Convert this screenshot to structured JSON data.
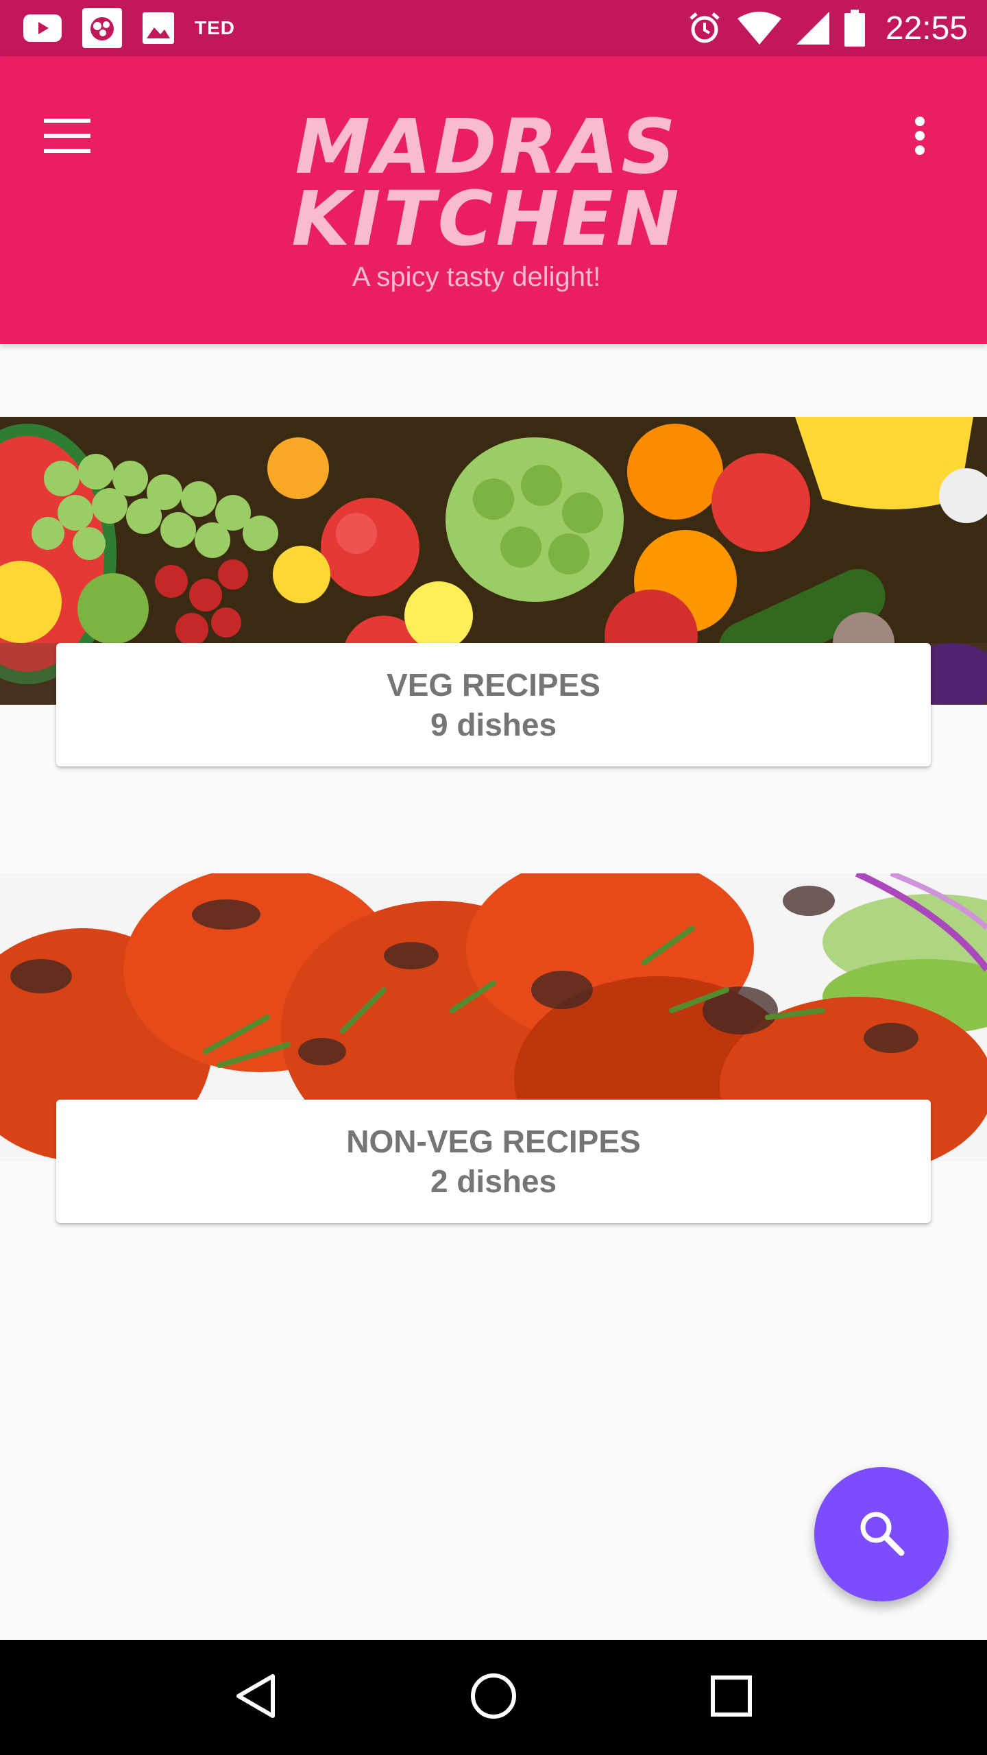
{
  "status_bar": {
    "left_icons": [
      "youtube-icon",
      "app-notification-icon",
      "image-icon"
    ],
    "ted_label": "TED",
    "right_icons": [
      "alarm-icon",
      "wifi-icon",
      "cell-signal-icon",
      "battery-icon"
    ],
    "time": "22:55"
  },
  "app_bar": {
    "logo_line1": "MADRAS",
    "logo_line2": "KITCHEN",
    "tagline": "A spicy tasty delight!",
    "menu_icon": "hamburger-menu-icon",
    "more_icon": "more-vert-icon"
  },
  "categories": [
    {
      "title": "VEG RECIPES",
      "count": "9 dishes",
      "image": "vegetables-photo"
    },
    {
      "title": "NON-VEG RECIPES",
      "count": "2 dishes",
      "image": "tandoori-chicken-photo"
    }
  ],
  "fab": {
    "icon": "search-icon"
  },
  "nav_bar": {
    "icons": [
      "back-icon",
      "home-icon",
      "recents-icon"
    ]
  },
  "colors": {
    "status_bar": "#c2185b",
    "app_bar": "#e91e63",
    "logo_text": "#f8bbd0",
    "fab": "#7c4dff",
    "card_text": "#757575",
    "background": "#fafafa"
  }
}
